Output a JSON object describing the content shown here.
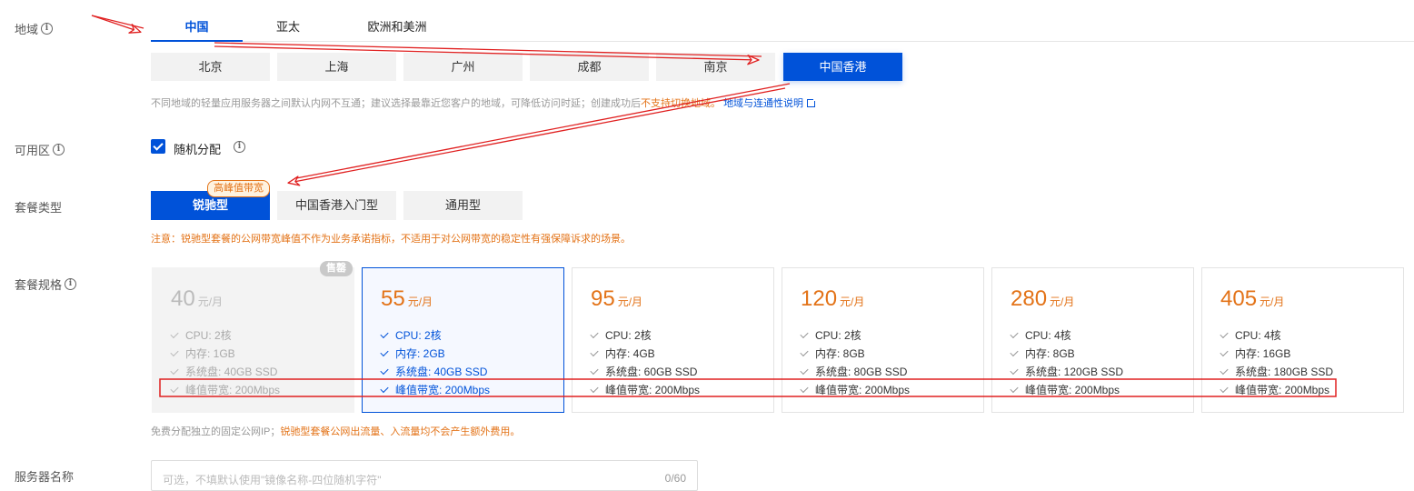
{
  "labels": {
    "region": "地域",
    "zone": "可用区",
    "plan_type": "套餐类型",
    "plan_spec": "套餐规格",
    "server_name": "服务器名称"
  },
  "region_tabs": [
    "中国",
    "亚太",
    "欧洲和美洲"
  ],
  "cities": [
    "北京",
    "上海",
    "广州",
    "成都",
    "南京",
    "中国香港"
  ],
  "region_hint": {
    "text": "不同地域的轻量应用服务器之间默认内网不互通；建议选择最靠近您客户的地域，可降低访问时延；创建成功后",
    "warn": "不支持切换地域。",
    "link": "地域与连通性说明"
  },
  "zone": {
    "checkbox_label": "随机分配"
  },
  "plan_types": {
    "badge": "高峰值带宽",
    "items": [
      "锐驰型",
      "中国香港入门型",
      "通用型"
    ]
  },
  "plan_note": "注意：锐驰型套餐的公网带宽峰值不作为业务承诺指标，不适用于对公网带宽的稳定性有强保障诉求的场景。",
  "cards": [
    {
      "price": "40",
      "unit": "元/月",
      "soldout": "售罄",
      "specs": [
        "CPU: 2核",
        "内存: 1GB",
        "系统盘: 40GB SSD",
        "峰值带宽: 200Mbps"
      ]
    },
    {
      "price": "55",
      "unit": "元/月",
      "specs": [
        "CPU: 2核",
        "内存: 2GB",
        "系统盘: 40GB SSD",
        "峰值带宽: 200Mbps"
      ]
    },
    {
      "price": "95",
      "unit": "元/月",
      "specs": [
        "CPU: 2核",
        "内存: 4GB",
        "系统盘: 60GB SSD",
        "峰值带宽: 200Mbps"
      ]
    },
    {
      "price": "120",
      "unit": "元/月",
      "specs": [
        "CPU: 2核",
        "内存: 8GB",
        "系统盘: 80GB SSD",
        "峰值带宽: 200Mbps"
      ]
    },
    {
      "price": "280",
      "unit": "元/月",
      "specs": [
        "CPU: 4核",
        "内存: 8GB",
        "系统盘: 120GB SSD",
        "峰值带宽: 200Mbps"
      ]
    },
    {
      "price": "405",
      "unit": "元/月",
      "specs": [
        "CPU: 4核",
        "内存: 16GB",
        "系统盘: 180GB SSD",
        "峰值带宽: 200Mbps"
      ]
    }
  ],
  "ip_hint": {
    "text": "免费分配独立的固定公网IP；",
    "warn": "锐驰型套餐公网出流量、入流量均不会产生额外费用。"
  },
  "server_name": {
    "placeholder": "可选，不填默认使用\"镜像名称-四位随机字符\"",
    "counter": "0/60"
  },
  "colors": {
    "accent": "#0052d9",
    "warning": "#e37318",
    "annotation": "#e02020"
  }
}
